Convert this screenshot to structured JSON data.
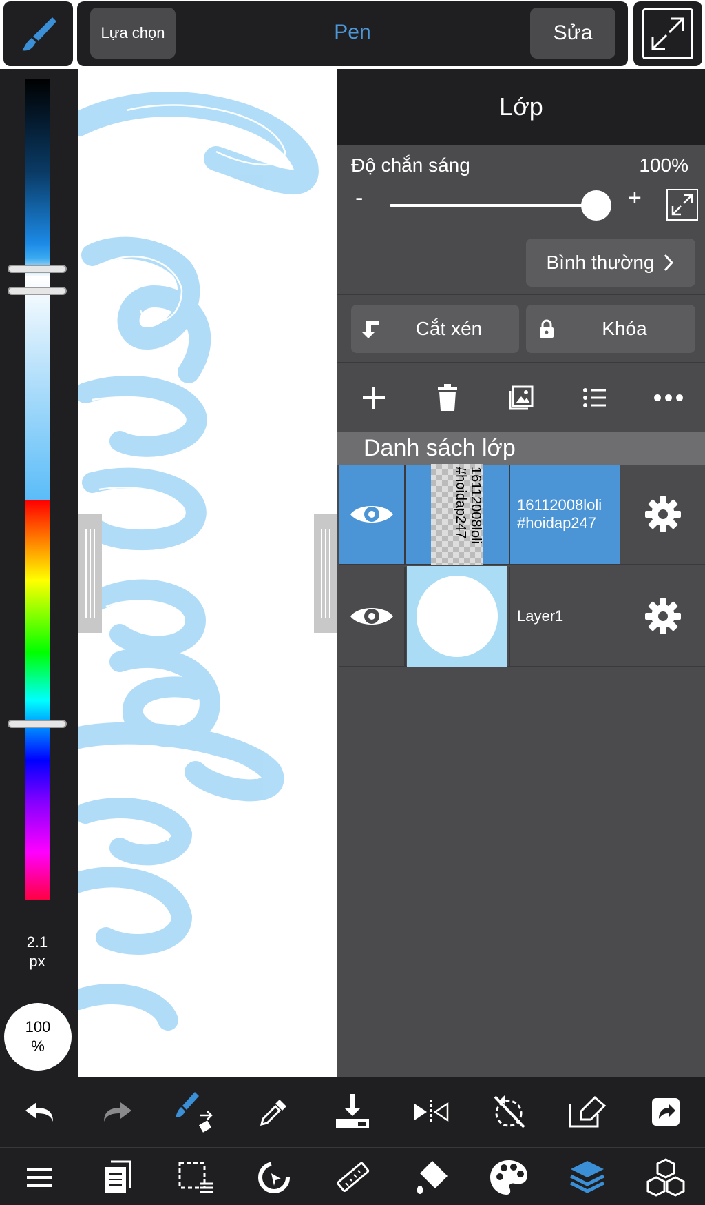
{
  "topbar": {
    "select_label": "Lựa chọn",
    "tool_name": "Pen",
    "edit_label": "Sửa"
  },
  "colors": {
    "accent": "#4d97d8",
    "selected_layer": "#4b95d6",
    "panel": "#4b4b4d",
    "dark": "#1f1f21"
  },
  "left_panel": {
    "brush_size_value": "2.1",
    "brush_size_unit": "px",
    "opacity_value": "100",
    "opacity_unit": "%"
  },
  "layer_panel": {
    "title": "Lớp",
    "opacity_label": "Độ chắn sáng",
    "opacity_value": "100%",
    "opacity_level": 1.0,
    "minus": "-",
    "plus": "+",
    "blend_mode": "Bình thường",
    "clipping_label": "Cắt xén",
    "lock_label": "Khóa",
    "list_header": "Danh sách lớp",
    "tools": [
      "add-icon",
      "trash-icon",
      "image-icon",
      "list-icon",
      "more-icon"
    ],
    "layers": [
      {
        "name_line1": "16112008loli",
        "name_line2": "#hoidap247",
        "thumb_text1": "16112008loli",
        "thumb_text2": "#hoidap247",
        "selected": true
      },
      {
        "name_line1": "Layer1",
        "name_line2": "",
        "selected": false
      }
    ]
  },
  "bottom_toolbar": {
    "row1": [
      "undo-icon",
      "redo-icon",
      "brush-swap-icon",
      "eyedropper-icon",
      "download-icon",
      "flip-icon",
      "rotate-off-icon",
      "eraser-icon",
      "share-icon"
    ],
    "row2": [
      "menu-icon",
      "pages-icon",
      "selection-icon",
      "transform-icon",
      "ruler-icon",
      "fill-icon",
      "palette-icon",
      "layers-icon",
      "materials-icon"
    ]
  }
}
